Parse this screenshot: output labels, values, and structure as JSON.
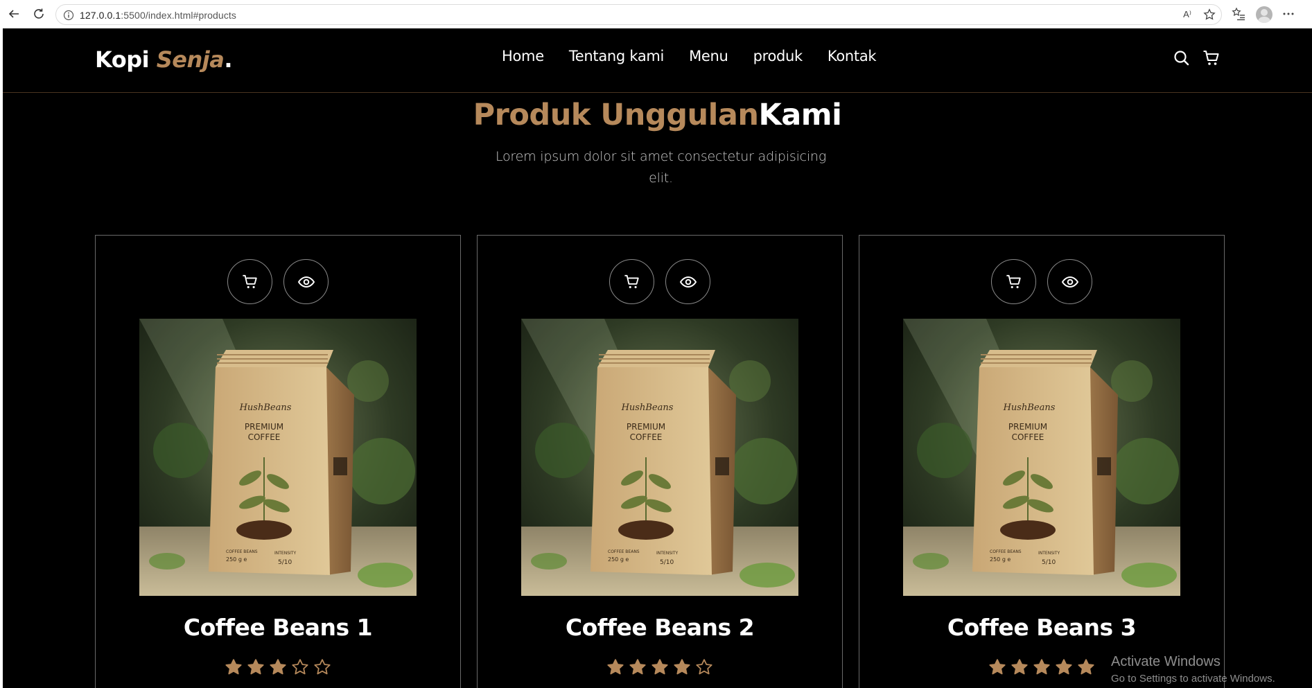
{
  "browser": {
    "url_host": "127.0.0.1",
    "url_rest": ":5500/index.html#products",
    "read_aloud_label": "A⁾"
  },
  "navbar": {
    "logo_main": "Kopi ",
    "logo_accent": "Senja",
    "logo_dot": ".",
    "links": [
      "Home",
      "Tentang kami",
      "Menu",
      "produk",
      "Kontak"
    ]
  },
  "section": {
    "title_accent": "Produk Unggulan",
    "title_rest": "Kami",
    "description": "Lorem ipsum dolor sit amet consectetur adipisicing elit."
  },
  "products": [
    {
      "name": "Coffee Beans 1",
      "rating": 3,
      "max_rating": 5
    },
    {
      "name": "Coffee Beans 2",
      "rating": 4,
      "max_rating": 5
    },
    {
      "name": "Coffee Beans 3",
      "rating": 5,
      "max_rating": 5
    }
  ],
  "packaging": {
    "brand": "HushBeans",
    "line1": "PREMIUM",
    "line2": "COFFEE",
    "weight_label": "COFFEE BEANS",
    "weight": "250 g e",
    "intensity_label": "INTENSITY",
    "intensity": "5/10"
  },
  "watermark": {
    "line1": "Activate Windows",
    "line2": "Go to Settings to activate Windows."
  },
  "colors": {
    "accent": "#b6895b",
    "background": "#000000",
    "star": "#b6895b"
  }
}
